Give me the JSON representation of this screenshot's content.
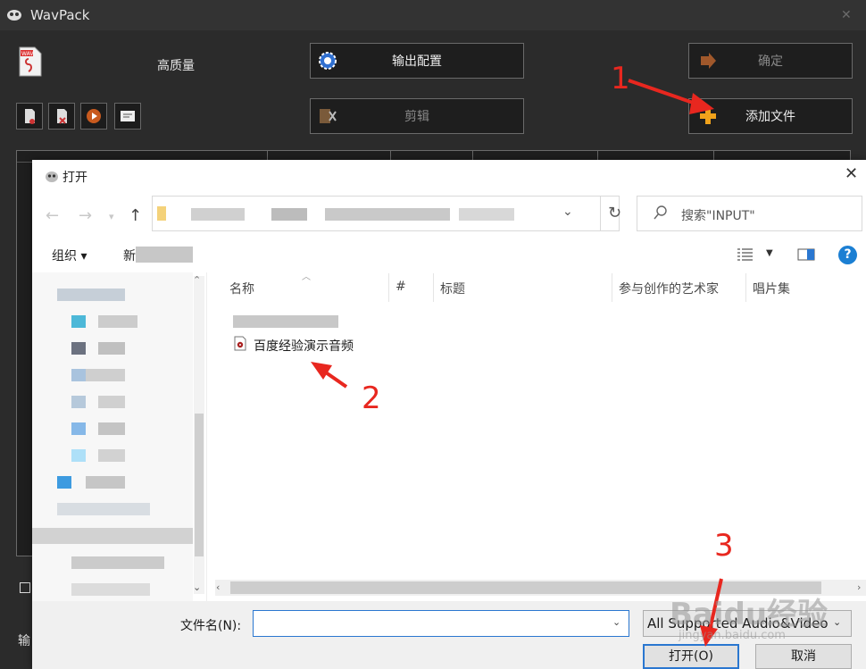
{
  "wavpack": {
    "title": "WavPack",
    "quality_label": "高质量",
    "buttons": {
      "output_config": "输出配置",
      "confirm": "确定",
      "edit": "剪辑",
      "add_file": "添加文件"
    },
    "output_label": "输"
  },
  "dialog": {
    "title": "打开",
    "search_placeholder": "搜索\"INPUT\"",
    "toolbar": {
      "organize": "组织 ▾",
      "new_folder": "新"
    },
    "columns": [
      "名称",
      "#",
      "标题",
      "参与创作的艺术家",
      "唱片集"
    ],
    "files": [
      {
        "name": "百度经验演示音频"
      }
    ],
    "filename_label": "文件名(N):",
    "filename_value": "",
    "filter_value": "All Supported Audio&Video",
    "open_button": "打开(O)",
    "cancel_button": "取消"
  },
  "annotations": {
    "step1": "1",
    "step2": "2",
    "step3": "3"
  },
  "watermark": {
    "logo": "Baidu经验",
    "url": "jingyan.baidu.com"
  },
  "colors": {
    "annotation": "#e8271f",
    "accent": "#2a77d0",
    "dark_bg": "#2b2b2b"
  }
}
